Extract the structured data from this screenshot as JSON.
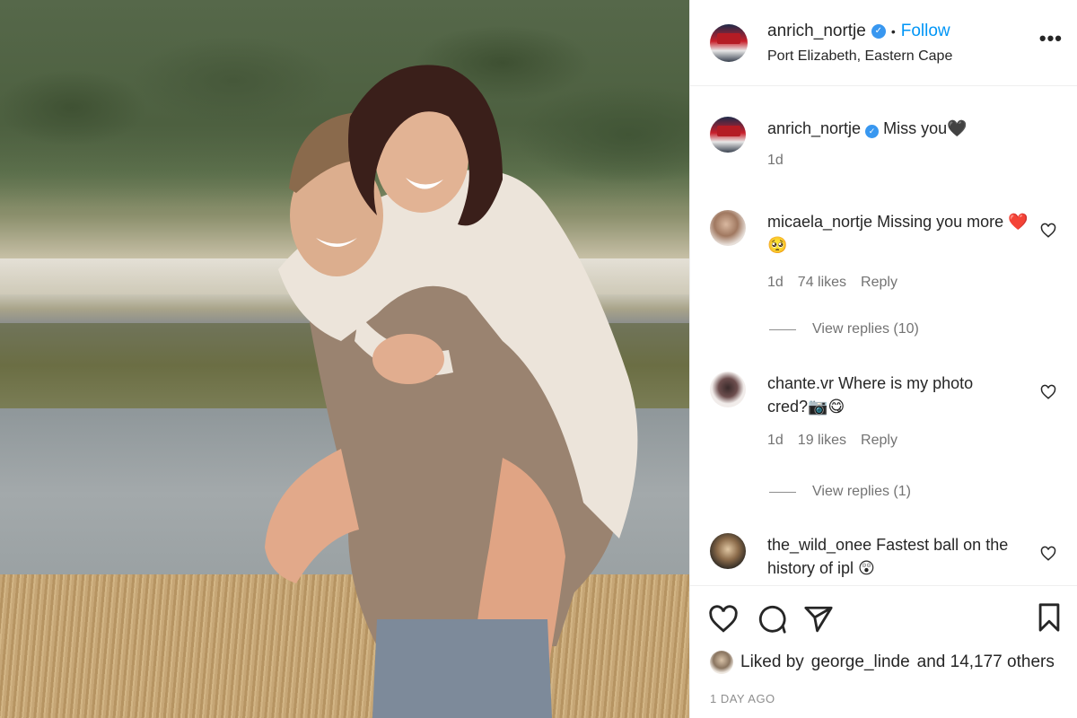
{
  "post": {
    "username": "anrich_nortje",
    "follow_label": "Follow",
    "separator": "•",
    "location": "Port Elizabeth, Eastern Cape",
    "more_label": "•••"
  },
  "caption": {
    "username": "anrich_nortje",
    "text": "Miss you🖤",
    "time": "1d"
  },
  "comments": [
    {
      "username": "micaela_nortje",
      "text": "Missing you more ❤️🥺",
      "time": "1d",
      "likes": "74 likes",
      "reply": "Reply",
      "view_replies": "View replies (10)"
    },
    {
      "username": "chante.vr",
      "text": "Where is my photo cred?📷😋",
      "time": "1d",
      "likes": "19 likes",
      "reply": "Reply",
      "view_replies": "View replies (1)"
    },
    {
      "username": "the_wild_onee",
      "text": "Fastest ball on the history of ipl 😲",
      "time": "",
      "likes": "",
      "reply": "",
      "view_replies": ""
    }
  ],
  "liked_by": {
    "prefix": "Liked by",
    "user": "george_linde",
    "suffix": "and 14,177 others"
  },
  "timestamp": "1 DAY AGO",
  "colors": {
    "accent": "#0095f6",
    "verified": "#3897f0",
    "text": "#262626",
    "muted": "#737373"
  },
  "icons": [
    "verified-icon",
    "more-icon",
    "heart-icon",
    "comment-icon",
    "share-icon",
    "bookmark-icon"
  ]
}
